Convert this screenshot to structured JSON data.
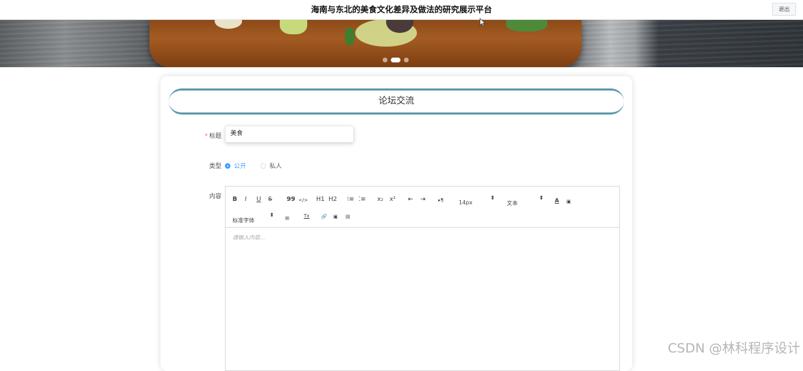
{
  "header": {
    "site_title": "海南与东北的美食文化差异及做法的研究展示平台",
    "logout_label": "退出"
  },
  "carousel": {
    "slides": 3,
    "active_index": 1
  },
  "form": {
    "card_title": "论坛交流",
    "title_label": "标题",
    "title_required_mark": "*",
    "title_value": "美食",
    "type_label": "类型",
    "type_options": [
      "公开",
      "私人"
    ],
    "type_selected": "公开",
    "content_label": "内容"
  },
  "editor": {
    "toolbar": {
      "bold": "B",
      "italic": "I",
      "underline": "U",
      "strike": "S",
      "blockquote": "99",
      "code": "</>",
      "h1": "H1",
      "h2": "H2",
      "ordered_list": "⁝≡",
      "bullet_list": "⁚≡",
      "subscript": "x₂",
      "superscript": "x²",
      "indent_decrease": "⇤",
      "indent_increase": "⇥",
      "direction": "▸¶",
      "size_value": "14px",
      "header_value": "文本",
      "color": "A",
      "background": "▣",
      "font_value": "标准字体",
      "align": "≡",
      "clean": "Tx",
      "link": "🔗",
      "image": "▣",
      "video": "▤"
    },
    "placeholder": "请输入内容..."
  },
  "watermark": "CSDN @林科程序设计"
}
